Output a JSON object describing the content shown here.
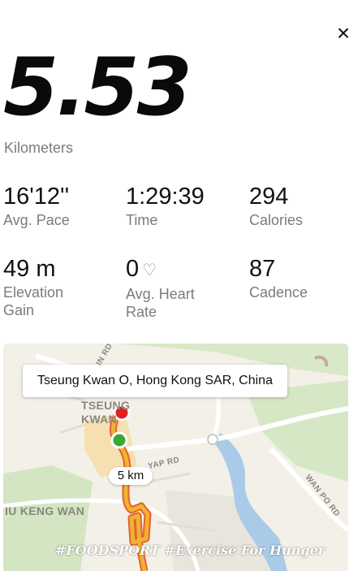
{
  "close": {
    "glyph": "×"
  },
  "summary": {
    "distance": "5.53",
    "distance_unit": "Kilometers"
  },
  "stats": {
    "pace": {
      "value": "16'12''",
      "label": "Avg. Pace"
    },
    "time": {
      "value": "1:29:39",
      "label": "Time"
    },
    "calories": {
      "value": "294",
      "label": "Calories"
    },
    "elevation": {
      "value": "49 m",
      "label_line1": "Elevation",
      "label_line2": "Gain"
    },
    "heart": {
      "value": "0",
      "icon": "heart-outline-icon",
      "icon_glyph": "♡",
      "label_line1": "Avg. Heart",
      "label_line2": "Rate"
    },
    "cadence": {
      "value": "87",
      "label": "Cadence"
    }
  },
  "map": {
    "location": "Tseung Kwan O, Hong Kong SAR, China",
    "km_marker": "5 km",
    "labels": {
      "tseung": "TSEUNG",
      "kwan": "KWAN",
      "iu_keng_wan": "IU KENG WAN",
      "yap_rd": "YAP RD",
      "wan_po_rd": "WAN PO RD",
      "in_rd": "IN RD"
    },
    "colors": {
      "route": "#f0b233",
      "route_dark": "#e8612c",
      "start": "#3aaa35",
      "end": "#e02020",
      "water": "#a9cbe8",
      "park": "#cde4bd"
    }
  },
  "watermark": "#FOODSPORT #Exercise For Hunger"
}
